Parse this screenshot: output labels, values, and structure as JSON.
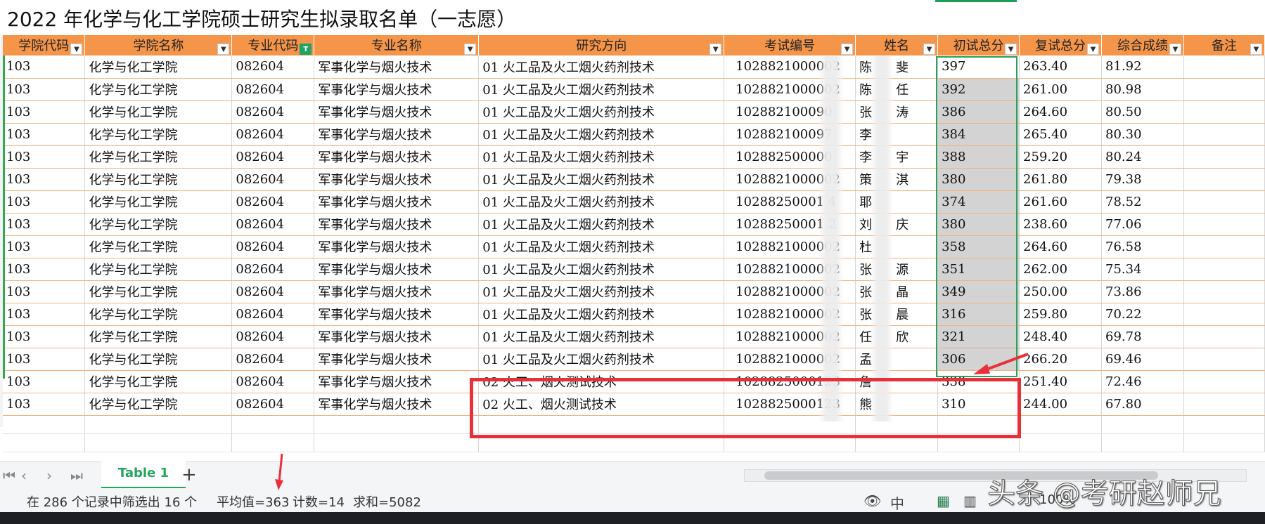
{
  "sheet": {
    "title": "2022 年化学与化工学院硕士研究生拟录取名单（一志愿）",
    "columns": [
      {
        "label": "学院代码",
        "filter": "dropdown"
      },
      {
        "label": "学院名称",
        "filter": "dropdown"
      },
      {
        "label": "专业代码",
        "filter": "active"
      },
      {
        "label": "专业名称",
        "filter": "dropdown"
      },
      {
        "label": "研究方向",
        "filter": "dropdown"
      },
      {
        "label": "考试编号",
        "filter": "dropdown"
      },
      {
        "label": "姓名",
        "filter": "dropdown"
      },
      {
        "label": "初试总分",
        "filter": "dropdown"
      },
      {
        "label": "复试总分",
        "filter": "dropdown"
      },
      {
        "label": "综合成绩",
        "filter": "dropdown"
      },
      {
        "label": "备注",
        "filter": "dropdown"
      }
    ],
    "rows": [
      [
        "103",
        "化学与化工学院",
        "082604",
        "军事化学与烟火技术",
        "01 火工品及火工烟火药剂技术",
        "1028821000002",
        "陈",
        "斐",
        "397",
        "263.40",
        "81.92",
        ""
      ],
      [
        "103",
        "化学与化工学院",
        "082604",
        "军事化学与烟火技术",
        "01 火工品及火工烟火药剂技术",
        "1028821000002",
        "陈",
        "任",
        "392",
        "261.00",
        "80.98",
        ""
      ],
      [
        "103",
        "化学与化工学院",
        "082604",
        "军事化学与烟火技术",
        "01 火工品及火工烟火药剂技术",
        "102882100090",
        "张",
        "涛",
        "386",
        "264.60",
        "80.50",
        ""
      ],
      [
        "103",
        "化学与化工学院",
        "082604",
        "军事化学与烟火技术",
        "01 火工品及火工烟火药剂技术",
        "102882100097",
        "李",
        "",
        "384",
        "265.40",
        "80.30",
        ""
      ],
      [
        "103",
        "化学与化工学院",
        "082604",
        "军事化学与烟火技术",
        "01 火工品及火工烟火药剂技术",
        "102882500000",
        "李",
        "宇",
        "388",
        "259.20",
        "80.24",
        ""
      ],
      [
        "103",
        "化学与化工学院",
        "082604",
        "军事化学与烟火技术",
        "01 火工品及火工烟火药剂技术",
        "1028821000002",
        "策",
        "淇",
        "380",
        "261.80",
        "79.38",
        ""
      ],
      [
        "103",
        "化学与化工学院",
        "082604",
        "军事化学与烟火技术",
        "01 火工品及火工烟火药剂技术",
        "10288250001 4",
        "耶",
        "",
        "374",
        "261.60",
        "78.52",
        ""
      ],
      [
        "103",
        "化学与化工学院",
        "082604",
        "军事化学与烟火技术",
        "01 火工品及火工烟火药剂技术",
        "10288250001 2",
        "刘",
        "庆",
        "380",
        "238.60",
        "77.06",
        ""
      ],
      [
        "103",
        "化学与化工学院",
        "082604",
        "军事化学与烟火技术",
        "01 火工品及火工烟火药剂技术",
        "1028821000002",
        "杜",
        "",
        "358",
        "264.60",
        "76.58",
        ""
      ],
      [
        "103",
        "化学与化工学院",
        "082604",
        "军事化学与烟火技术",
        "01 火工品及火工烟火药剂技术",
        "1028821000002",
        "张",
        "源",
        "351",
        "262.00",
        "75.34",
        ""
      ],
      [
        "103",
        "化学与化工学院",
        "082604",
        "军事化学与烟火技术",
        "01 火工品及火工烟火药剂技术",
        "1028821000002",
        "张",
        "晶",
        "349",
        "250.00",
        "73.86",
        ""
      ],
      [
        "103",
        "化学与化工学院",
        "082604",
        "军事化学与烟火技术",
        "01 火工品及火工烟火药剂技术",
        "1028821000002",
        "张",
        "晨",
        "316",
        "259.80",
        "70.22",
        ""
      ],
      [
        "103",
        "化学与化工学院",
        "082604",
        "军事化学与烟火技术",
        "01 火工品及火工烟火药剂技术",
        "1028821000002",
        "任",
        "欣",
        "321",
        "248.40",
        "69.78",
        ""
      ],
      [
        "103",
        "化学与化工学院",
        "082604",
        "军事化学与烟火技术",
        "01 火工品及火工烟火药剂技术",
        "1028821000002",
        "孟",
        "",
        "306",
        "266.20",
        "69.46",
        ""
      ],
      [
        "103",
        "化学与化工学院",
        "082604",
        "军事化学与烟火技术",
        "02 火工、烟火测试技术",
        "1028825000123",
        "詹",
        "",
        "338",
        "251.40",
        "72.46",
        ""
      ],
      [
        "103",
        "化学与化工学院",
        "082604",
        "军事化学与烟火技术",
        "02 火工、烟火测试技术",
        "1028825000123",
        "熊",
        "",
        "310",
        "244.00",
        "67.80",
        ""
      ]
    ]
  },
  "tabs": {
    "first": "⏮",
    "prev": "‹",
    "next": "›",
    "last": "⏭",
    "sheet_tab": "Table 1",
    "add": "+"
  },
  "status": {
    "filter_info": "在 286 个记录中筛选出 16 个",
    "average": "平均值=363",
    "count": "计数=14",
    "sum": "求和=5082",
    "zoom": "100%"
  },
  "watermark": "头条 @考研赵师兄",
  "colors": {
    "header": "#f4954a",
    "selection": "#2aa15a",
    "highlight_box": "#e8303b",
    "tab_active": "#22a65b"
  }
}
